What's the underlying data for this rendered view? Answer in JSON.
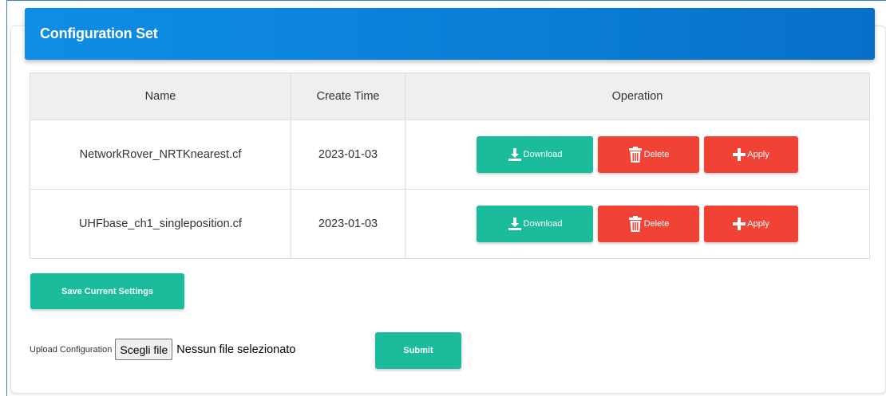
{
  "panel": {
    "title": "Configuration Set"
  },
  "table": {
    "headers": [
      "Name",
      "Create Time",
      "Operation"
    ],
    "rows": [
      {
        "name": "NetworkRover_NRTKnearest.cf",
        "time": "2023-01-03"
      },
      {
        "name": "UHFbase_ch1_singleposition.cf",
        "time": "2023-01-03"
      }
    ],
    "actions": {
      "download": "Download",
      "delete": "Delete",
      "apply": "Apply"
    }
  },
  "save_button": "Save Current Settings",
  "upload": {
    "label": "Upload Configuration",
    "choose_button": "Scegli file",
    "status": "Nessun file selezionato",
    "submit": "Submit"
  },
  "colors": {
    "header": "#0a7fd6",
    "success": "#1abc9c",
    "danger": "#f04335"
  },
  "icons": {
    "download": "download-icon",
    "delete": "trash-icon",
    "apply": "plus-icon"
  }
}
